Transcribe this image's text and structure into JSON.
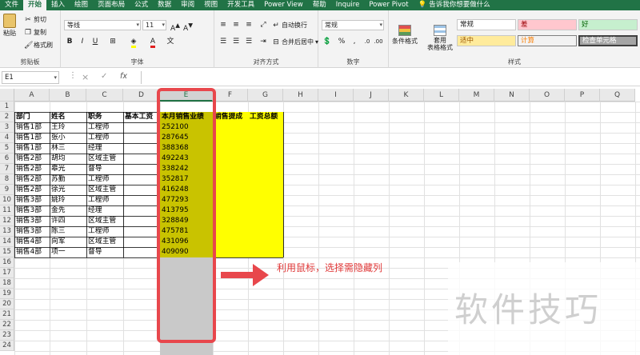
{
  "menu": {
    "tabs": [
      "文件",
      "开始",
      "插入",
      "绘图",
      "页面布局",
      "公式",
      "数据",
      "审阅",
      "视图",
      "开发工具",
      "Power View",
      "帮助",
      "Inquire",
      "Power Pivot"
    ],
    "active_tab": "开始",
    "tell_me": "告诉我你想要做什么"
  },
  "ribbon": {
    "clipboard": {
      "label": "剪贴板",
      "paste": "粘贴",
      "cut": "剪切",
      "copy": "复制",
      "format_painter": "格式刷"
    },
    "font": {
      "label": "字体",
      "font_name": "等线",
      "font_size": "11",
      "bold": "B",
      "italic": "I",
      "underline": "U"
    },
    "alignment": {
      "label": "对齐方式",
      "wrap_text": "自动换行",
      "merge_center": "合并后居中"
    },
    "number": {
      "label": "数字",
      "format": "常规",
      "percent": "%",
      "comma": ","
    },
    "styles": {
      "label": "样式",
      "conditional_format": "条件格式",
      "format_as_table": "套用\n表格格式",
      "cells": [
        "常规",
        "差",
        "好",
        "适中",
        "计算",
        "检查单元格"
      ]
    }
  },
  "formula_bar": {
    "name_box": "E1",
    "cancel": "×",
    "enter": "✓",
    "fx": "fx",
    "value": ""
  },
  "columns": [
    "A",
    "B",
    "C",
    "D",
    "E",
    "F",
    "G",
    "H",
    "I",
    "J",
    "K",
    "L",
    "M",
    "N",
    "O",
    "P",
    "Q"
  ],
  "selected_column": "E",
  "rows": [
    "1",
    "2",
    "3",
    "4",
    "5",
    "6",
    "7",
    "8",
    "9",
    "10",
    "11",
    "12",
    "13",
    "14",
    "15",
    "16",
    "17",
    "18",
    "19",
    "20",
    "21",
    "22",
    "23",
    "24"
  ],
  "table": {
    "headers": [
      "部门",
      "姓名",
      "职务",
      "基本工资",
      "本月销售业绩",
      "销售提成",
      "工资总额"
    ],
    "rows": [
      [
        "销售1部",
        "王玲",
        "工程师",
        "",
        "252100"
      ],
      [
        "销售1部",
        "张小",
        "工程师",
        "",
        "287645"
      ],
      [
        "销售1部",
        "林三",
        "经理",
        "",
        "388368"
      ],
      [
        "销售2部",
        "胡均",
        "区域主管",
        "",
        "492243"
      ],
      [
        "销售2部",
        "皋光",
        "督导",
        "",
        "338242"
      ],
      [
        "销售2部",
        "苏勤",
        "工程师",
        "",
        "352817"
      ],
      [
        "销售2部",
        "徐光",
        "区域主管",
        "",
        "416248"
      ],
      [
        "销售3部",
        "姚玲",
        "工程师",
        "",
        "477293"
      ],
      [
        "销售3部",
        "金先",
        "经理",
        "",
        "413795"
      ],
      [
        "销售3部",
        "许四",
        "区域主管",
        "",
        "328849"
      ],
      [
        "销售3部",
        "陈三",
        "工程师",
        "",
        "475781"
      ],
      [
        "销售4部",
        "向军",
        "区域主管",
        "",
        "431096"
      ],
      [
        "销售4部",
        "项一",
        "督导",
        "",
        "409090"
      ]
    ]
  },
  "annotation": {
    "text": "利用鼠标，选择需隐藏列",
    "color": "#e03a3a"
  },
  "watermark": "软件技巧",
  "colors": {
    "excel_green": "#217346",
    "highlight_yellow": "#ffff00",
    "highlight_olive": "#c9c300",
    "annotation_red": "#e8474c"
  }
}
